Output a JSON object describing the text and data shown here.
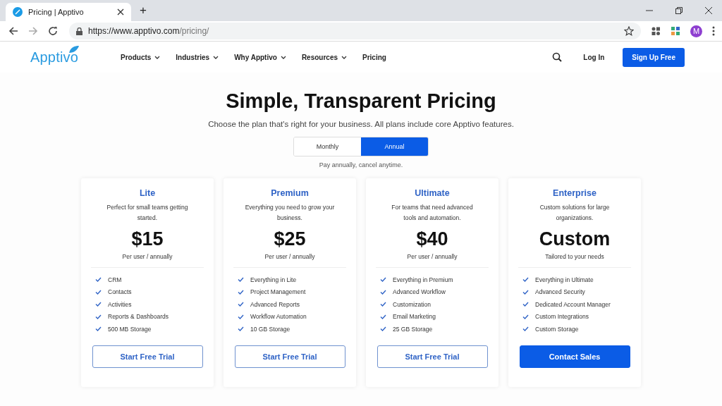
{
  "browser": {
    "tab_title": "Pricing | Apptivo",
    "new_tab": "+",
    "url_host": "https://www.apptivo.com",
    "url_path": "/pricing/",
    "profile": "M"
  },
  "site": {
    "logo": "Apptivo",
    "nav": [
      {
        "label": "Products",
        "has_menu": true
      },
      {
        "label": "Industries",
        "has_menu": true
      },
      {
        "label": "Why Apptivo",
        "has_menu": true
      },
      {
        "label": "Resources",
        "has_menu": true
      },
      {
        "label": "Pricing",
        "has_menu": false
      }
    ],
    "login": "Log In",
    "signup": "Sign Up Free"
  },
  "hero": {
    "title": "Simple, Transparent Pricing",
    "subtitle": "Choose the plan that's right for your business. All plans include core Apptivo features.",
    "billing": [
      {
        "label": "Monthly",
        "selected": false
      },
      {
        "label": "Annual",
        "selected": true
      }
    ],
    "note": "Pay annually, cancel anytime."
  },
  "plans": [
    {
      "name": "Lite",
      "description": "Perfect for small teams getting started.",
      "price": "$15",
      "period": "Per user / annually",
      "features": [
        "CRM",
        "Contacts",
        "Activities",
        "Reports & Dashboards",
        "500 MB Storage"
      ],
      "button": {
        "label": "Start Free Trial",
        "kind": "outline"
      }
    },
    {
      "name": "Premium",
      "description": "Everything you need to grow your business.",
      "price": "$25",
      "period": "Per user / annually",
      "features": [
        "Everything in Lite",
        "Project Management",
        "Advanced Reports",
        "Workflow Automation",
        "10 GB Storage"
      ],
      "button": {
        "label": "Start Free Trial",
        "kind": "outline"
      }
    },
    {
      "name": "Ultimate",
      "description": "For teams that need advanced tools and automation.",
      "price": "$40",
      "period": "Per user / annually",
      "features": [
        "Everything in Premium",
        "Advanced Workflow",
        "Customization",
        "Email Marketing",
        "25 GB Storage"
      ],
      "button": {
        "label": "Start Free Trial",
        "kind": "outline"
      }
    },
    {
      "name": "Enterprise",
      "description": "Custom solutions for large organizations.",
      "price": "Custom",
      "period": "Tailored to your needs",
      "features": [
        "Everything in Ultimate",
        "Advanced Security",
        "Dedicated Account Manager",
        "Custom Integrations",
        "Custom Storage"
      ],
      "button": {
        "label": "Contact Sales",
        "kind": "filled"
      }
    }
  ]
}
